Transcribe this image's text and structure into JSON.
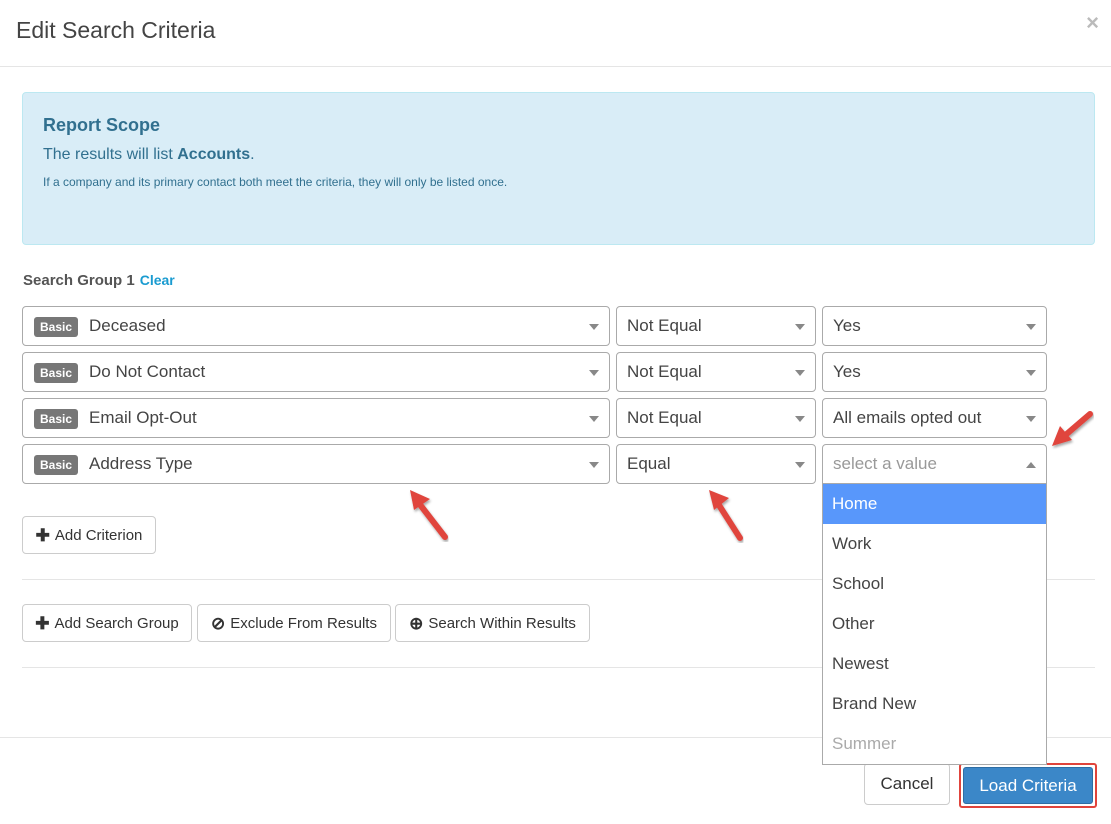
{
  "modal": {
    "title": "Edit Search Criteria",
    "close": "×"
  },
  "scope": {
    "title": "Report Scope",
    "line1_prefix": "The results will list ",
    "line1_entity": "Accounts",
    "line1_suffix": ".",
    "line2": "If a company and its primary contact both meet the criteria, they will only be listed once."
  },
  "group": {
    "label": "Search Group 1",
    "clear": "Clear"
  },
  "criteria": [
    {
      "badge": "Basic",
      "field": "Deceased",
      "operator": "Not Equal",
      "value": "Yes"
    },
    {
      "badge": "Basic",
      "field": "Do Not Contact",
      "operator": "Not Equal",
      "value": "Yes"
    },
    {
      "badge": "Basic",
      "field": "Email Opt-Out",
      "operator": "Not Equal",
      "value": "All emails opted out"
    },
    {
      "badge": "Basic",
      "field": "Address Type",
      "operator": "Equal",
      "value_placeholder": "select a value"
    }
  ],
  "buttons": {
    "add_criterion": "Add Criterion",
    "add_search_group": "Add Search Group",
    "exclude": "Exclude From Results",
    "search_within": "Search Within Results",
    "cancel": "Cancel",
    "load": "Load Criteria"
  },
  "dropdown": {
    "options": [
      "Home",
      "Work",
      "School",
      "Other",
      "Newest",
      "Brand New",
      "Summer"
    ],
    "highlighted": "Home"
  },
  "colors": {
    "accent": "#3b87c8",
    "highlight": "#5897fb",
    "annotation": "#e0443c",
    "info_bg": "#d9edf7"
  }
}
